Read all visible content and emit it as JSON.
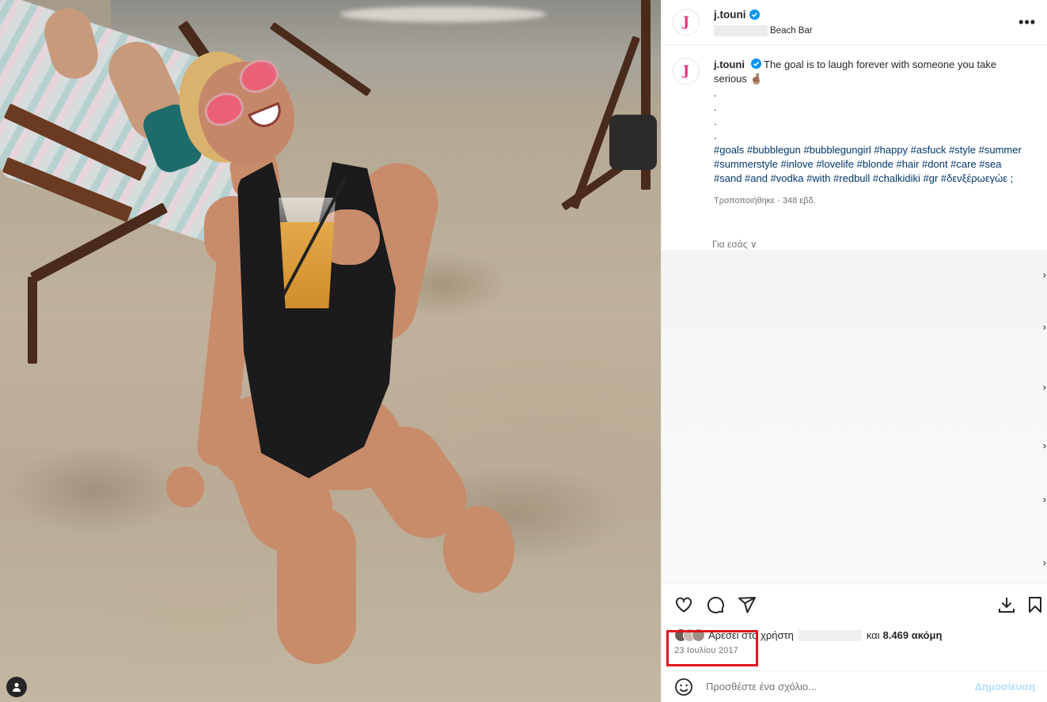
{
  "photo": {
    "alt": ""
  },
  "post": {
    "username": "j.touni",
    "avatar_letter": "J",
    "location_suffix": "Beach Bar",
    "more_icon": "more-horizontal-icon",
    "caption_text": "The goal is to laugh forever with someone you take serious 🤞🏽",
    "caption_dots": [
      ".",
      ".",
      ".",
      "."
    ],
    "hashtags": "#goals #bubblegun #bubblegungirl #happy #asfuck #style #summer #summerstyle #inlove #lovelife #blonde #hair #dont #care #sea #sand #and #vodka #with #redbull #chalkidiki #gr #δενξέρωεγώε ;",
    "edited_meta": "Τροποποιήθηκε · 348 εβδ.",
    "for_you": "Για εσάς ∨"
  },
  "actions": {
    "like_icon": "heart-icon",
    "comment_icon": "comment-icon",
    "share_icon": "send-icon",
    "download_icon": "download-icon",
    "save_icon": "bookmark-icon"
  },
  "likes": {
    "prefix": "Αρέσει στο χρήστη",
    "and": "και",
    "count": "8.469 ακόμη"
  },
  "date": "23 Ιουλίου 2017",
  "comment": {
    "placeholder": "Προσθέστε ένα σχόλιο...",
    "post_label": "Δημοσίευση"
  },
  "colors": {
    "accent_link": "#00376b",
    "verified": "#0095f6",
    "highlight": "#e0161b",
    "brand_letter": "#e2317b"
  }
}
